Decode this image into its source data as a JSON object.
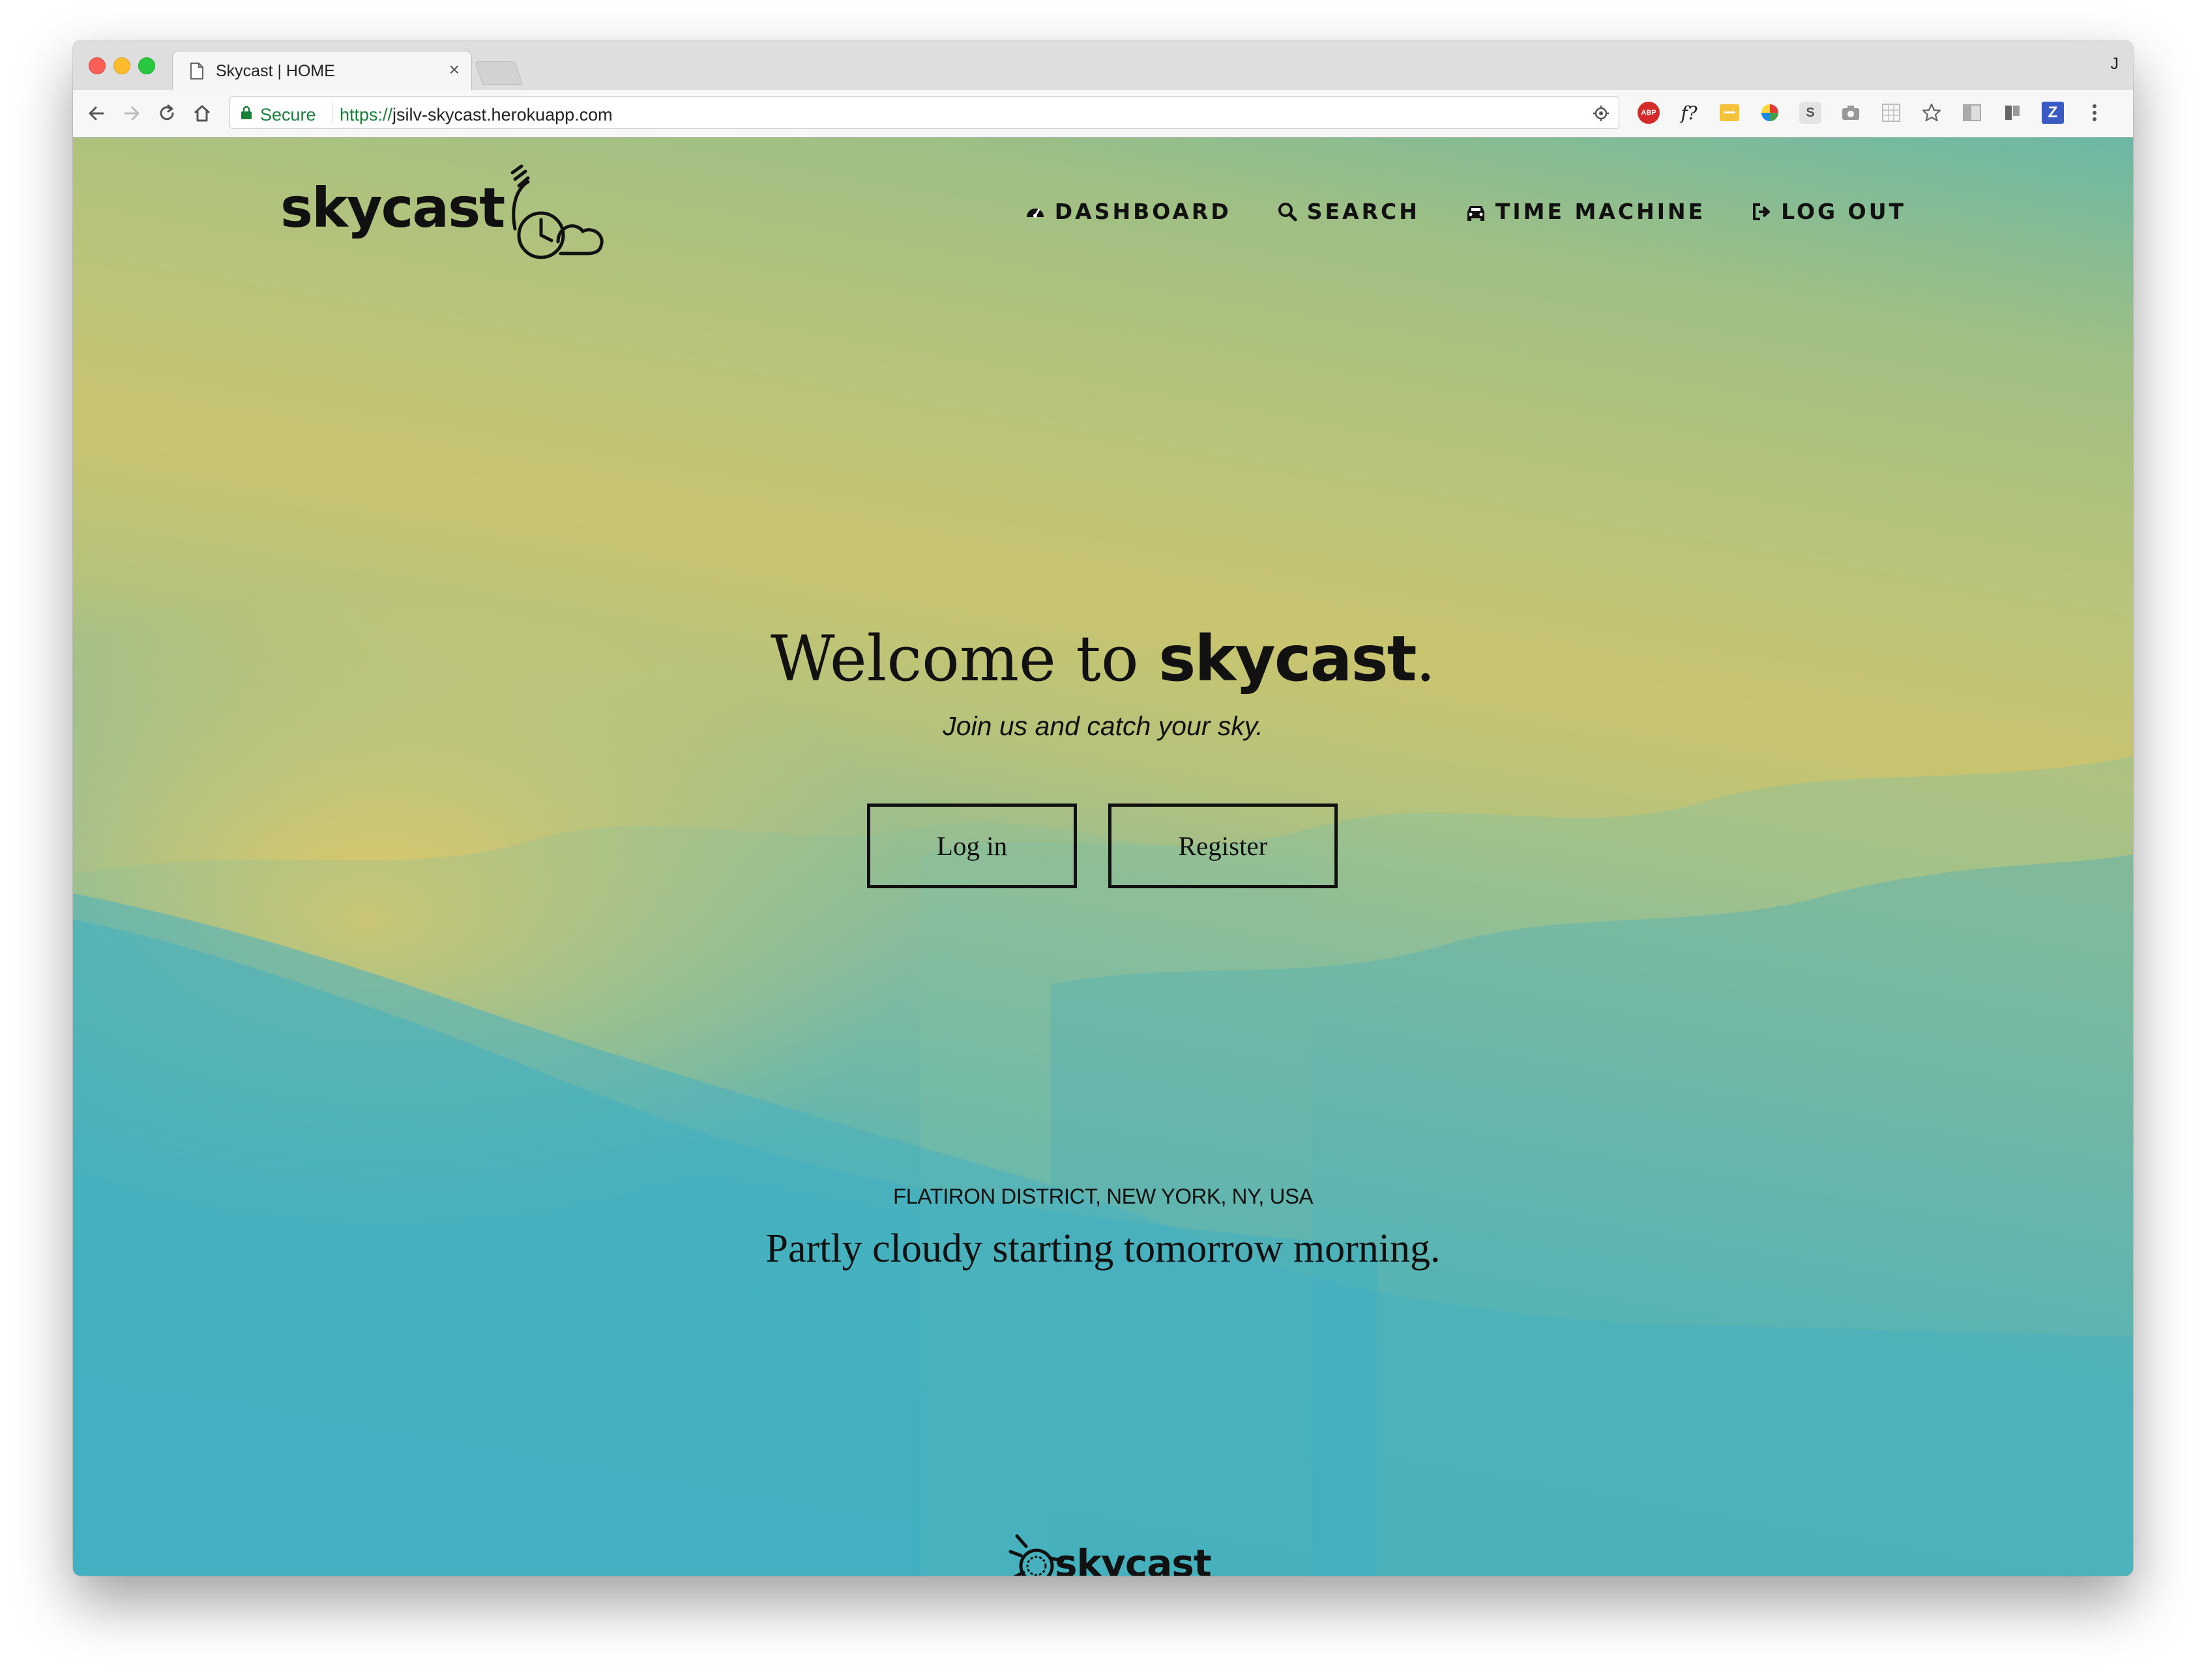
{
  "browser": {
    "tab_title": "Skycast | HOME",
    "tab_close": "×",
    "profile_letter": "J",
    "secure_label": "Secure",
    "url_scheme": "https://",
    "url_host": "jsilv-skycast.herokuapp.com",
    "extensions": [
      "abp-icon",
      "fontface-icon",
      "notes-icon",
      "colorpicker-icon",
      "s-icon",
      "camera-icon",
      "grid-icon",
      "star-icon",
      "reader-icon",
      "bookmark-icon",
      "z-icon",
      "menu-icon"
    ],
    "ext_labels": {
      "abp": "ABP",
      "fontface": "f?",
      "s": "S",
      "z": "Z"
    }
  },
  "header": {
    "brand": "skycast",
    "nav": [
      {
        "label": "DASHBOARD",
        "icon": "dashboard-icon"
      },
      {
        "label": "SEARCH",
        "icon": "search-icon"
      },
      {
        "label": "TIME MACHINE",
        "icon": "car-icon"
      },
      {
        "label": "LOG OUT",
        "icon": "sign-out-icon"
      }
    ]
  },
  "hero": {
    "title_prefix": "Welcome to ",
    "title_brand": "skycast",
    "title_suffix": ".",
    "subtitle": "Join us and catch your sky.",
    "login_label": "Log in",
    "register_label": "Register"
  },
  "weather": {
    "location": "FLATIRON DISTRICT, NEW YORK, NY, USA",
    "summary": "Partly cloudy starting tomorrow morning."
  },
  "footer": {
    "brand": "skycast"
  },
  "colors": {
    "secure_green": "#188038",
    "sky_top": "#6bb8a5",
    "sky_sun": "#f6cc58",
    "sky_bottom": "#27abcc"
  }
}
